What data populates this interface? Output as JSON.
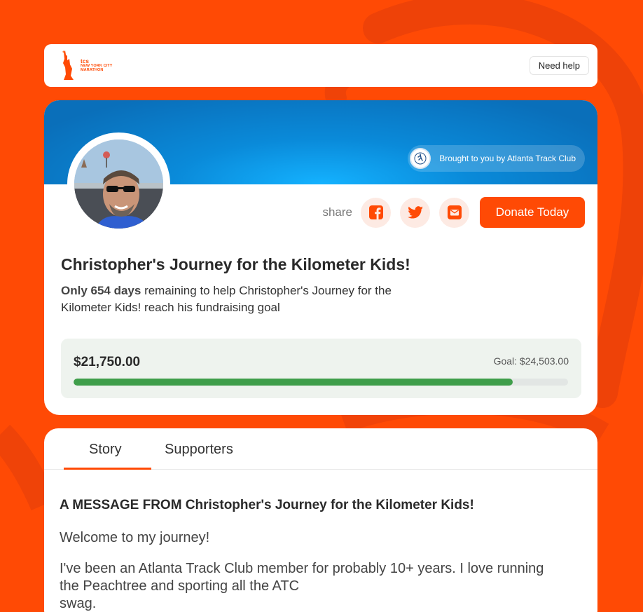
{
  "header": {
    "logo_tcs": "tcs",
    "logo_line1": "NEW YORK CITY",
    "logo_line2": "MARATHON",
    "help_label": "Need help"
  },
  "profile": {
    "brought_by": "Brought to you by Atlanta Track Club",
    "share_label": "share",
    "social_icons": [
      "facebook-icon",
      "twitter-icon",
      "email-icon"
    ],
    "donate_label": "Donate Today",
    "title": "Christopher's Journey for the Kilometer Kids!",
    "days_bold": "Only 654 days",
    "days_rest": " remaining to help Christopher's Journey for the Kilometer Kids! reach his fundraising goal",
    "raised": "$21,750.00",
    "goal": "Goal: $24,503.00",
    "progress_fraction": 0.8877
  },
  "story": {
    "tabs": [
      "Story",
      "Supporters"
    ],
    "active_tab": "Story",
    "heading": "A MESSAGE FROM Christopher's Journey for the Kilometer Kids!",
    "para1": "Welcome to my journey!",
    "para2_line1": "I've been an Atlanta Track Club member for probably 10+ years. I love running",
    "para2_line2": "the Peachtree and sporting all the ATC",
    "para2_line3": "swag."
  },
  "colors": {
    "brand_orange": "#FF4A05",
    "banner_blue": "#0a8ad9",
    "progress_green": "#3f9e4a"
  }
}
